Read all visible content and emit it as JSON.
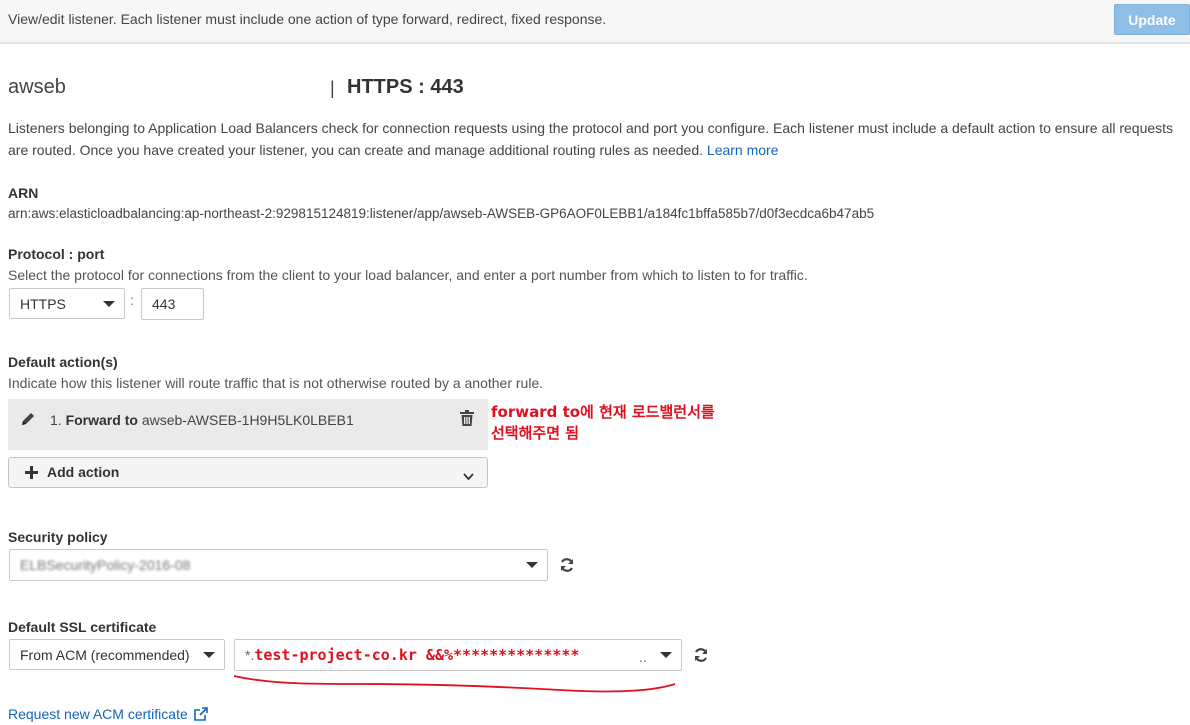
{
  "topbar": {
    "message": "View/edit listener. Each listener must include one action of type forward, redirect, fixed response.",
    "update_label": "Update"
  },
  "header": {
    "load_balancer": "awseb",
    "separator": "|",
    "listener": "HTTPS : 443"
  },
  "description": {
    "text": "Listeners belonging to Application Load Balancers check for connection requests using the protocol and port you configure. Each listener must include a default action to ensure all requests are routed. Once you have created your listener, you can create and manage additional routing rules as needed.",
    "learn_more": "Learn more"
  },
  "arn": {
    "label": "ARN",
    "value": "arn:aws:elasticloadbalancing:ap-northeast-2:929815124819:listener/app/awseb-AWSEB-GP6AOF0LEBB1/a184fc1bffa585b7/d0f3ecdca6b47ab5"
  },
  "protocol": {
    "label": "Protocol : port",
    "help": "Select the protocol for connections from the client to your load balancer, and enter a port number from which to listen to for traffic.",
    "protocol_value": "HTTPS",
    "colon": ":",
    "port_value": "443"
  },
  "default_actions": {
    "label": "Default action(s)",
    "help": "Indicate how this listener will route traffic that is not otherwise routed by a another rule.",
    "action_prefix": "1. ",
    "action_type": "Forward to",
    "action_target": "awseb-AWSEB-1H9H5LK0LBEB1",
    "add_action_label": "Add action"
  },
  "annotation": {
    "line1": "forward to에 현재 로드밸런서를",
    "line2": "선택해주면 됨",
    "color": "#e0101e"
  },
  "security_policy": {
    "label": "Security policy",
    "value": "ELBSecurityPolicy-2016-08"
  },
  "ssl": {
    "label": "Default SSL certificate",
    "source_value": "From ACM (recommended)",
    "cert_prefix": "*.",
    "cert_value": "test-project-co.kr &&%**************",
    "cert_suffix": "..",
    "request_link": "Request new ACM certificate"
  },
  "colors": {
    "link": "#1166bb",
    "update_button": "#8ebde6",
    "annotation_red": "#e0101e"
  },
  "icons": [
    "pencil-icon",
    "trash-icon",
    "plus-icon",
    "chevron-down-icon",
    "refresh-icon",
    "external-link-icon"
  ]
}
